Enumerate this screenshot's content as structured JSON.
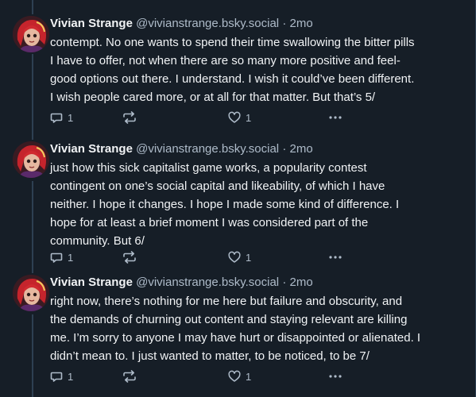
{
  "posts": [
    {
      "author": "Vivian Strange",
      "handle": "@vivianstrange.bsky.social",
      "separator": "·",
      "time": "2mo",
      "text": "contempt. No one wants to spend their time swallowing the bitter pills\nI have to offer, not when there are so many more positive and feel-\ngood options out there. I understand. I wish it could’ve been different.\nI wish people cared more, or at all for that matter. But that’s 5/",
      "reply_count": "1",
      "like_count": "1"
    },
    {
      "author": "Vivian Strange",
      "handle": "@vivianstrange.bsky.social",
      "separator": "·",
      "time": "2mo",
      "text": "just how this sick capitalist game works, a popularity contest\ncontingent on one’s social capital and likeability, of which I have\nneither. I hope it changes. I hope I made some kind of difference. I\nhope for at least a brief moment I was considered part of the\ncommunity. But 6/",
      "reply_count": "1",
      "like_count": "1"
    },
    {
      "author": "Vivian Strange",
      "handle": "@vivianstrange.bsky.social",
      "separator": "·",
      "time": "2mo",
      "text": "right now, there’s nothing for me here but failure and obscurity, and\nthe demands of churning out content and staying relevant are killing\nme. I’m sorry to anyone I may have hurt or disappointed or alienated. I\ndidn’t mean to. I just wanted to matter, to be noticed, to be 7/",
      "reply_count": "1",
      "like_count": "1"
    }
  ],
  "icons": {
    "reply": "reply-icon",
    "repost": "repost-icon",
    "like": "heart-icon",
    "more": "more-options-icon"
  },
  "colors": {
    "background": "#161e27",
    "text": "#f1f3f5",
    "muted": "#aebbc9",
    "thread_line": "#2e4052"
  }
}
